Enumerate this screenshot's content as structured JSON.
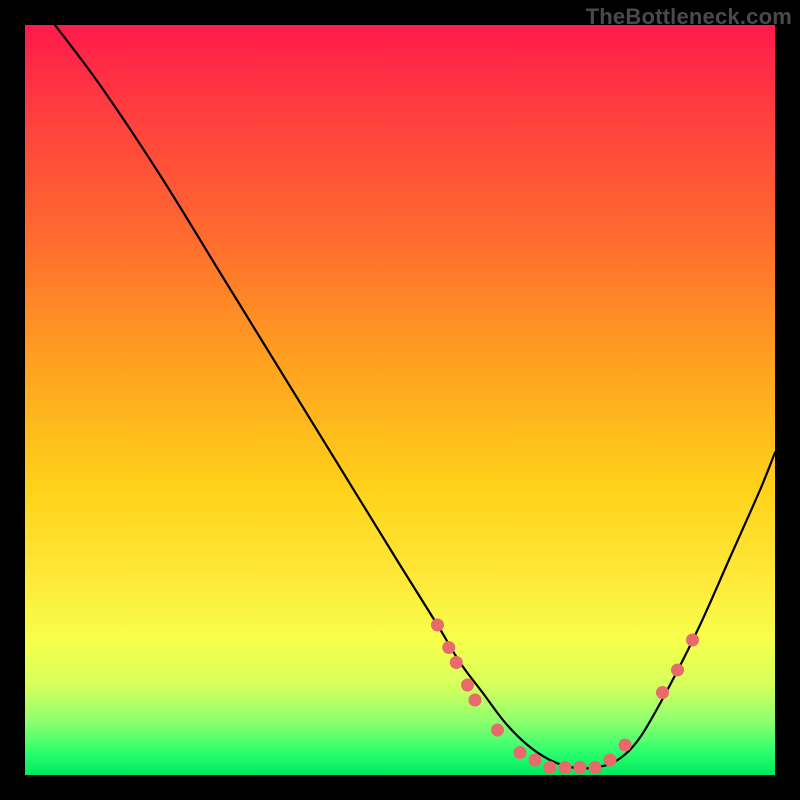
{
  "watermark": "TheBottleneck.com",
  "colors": {
    "background": "#000000",
    "curve": "#000000",
    "markers": "#e86a6a"
  },
  "chart_data": {
    "type": "line",
    "title": "",
    "xlabel": "",
    "ylabel": "",
    "xlim": [
      0,
      100
    ],
    "ylim": [
      0,
      100
    ],
    "grid": false,
    "legend": false,
    "series": [
      {
        "name": "curve",
        "x": [
          4,
          10,
          18,
          26,
          34,
          42,
          50,
          55,
          58,
          61,
          64,
          67,
          70,
          73,
          76,
          79,
          82,
          86,
          90,
          94,
          98,
          100
        ],
        "y": [
          100,
          92,
          80,
          67,
          54,
          41,
          28,
          20,
          15,
          11,
          7,
          4,
          2,
          1,
          1,
          2,
          5,
          12,
          20,
          29,
          38,
          43
        ]
      }
    ],
    "markers": [
      {
        "x": 55,
        "y": 20
      },
      {
        "x": 56.5,
        "y": 17
      },
      {
        "x": 57.5,
        "y": 15
      },
      {
        "x": 59,
        "y": 12
      },
      {
        "x": 60,
        "y": 10
      },
      {
        "x": 63,
        "y": 6
      },
      {
        "x": 66,
        "y": 3
      },
      {
        "x": 68,
        "y": 2
      },
      {
        "x": 70,
        "y": 1
      },
      {
        "x": 72,
        "y": 1
      },
      {
        "x": 74,
        "y": 1
      },
      {
        "x": 76,
        "y": 1
      },
      {
        "x": 78,
        "y": 2
      },
      {
        "x": 80,
        "y": 4
      },
      {
        "x": 85,
        "y": 11
      },
      {
        "x": 87,
        "y": 14
      },
      {
        "x": 89,
        "y": 18
      }
    ]
  }
}
